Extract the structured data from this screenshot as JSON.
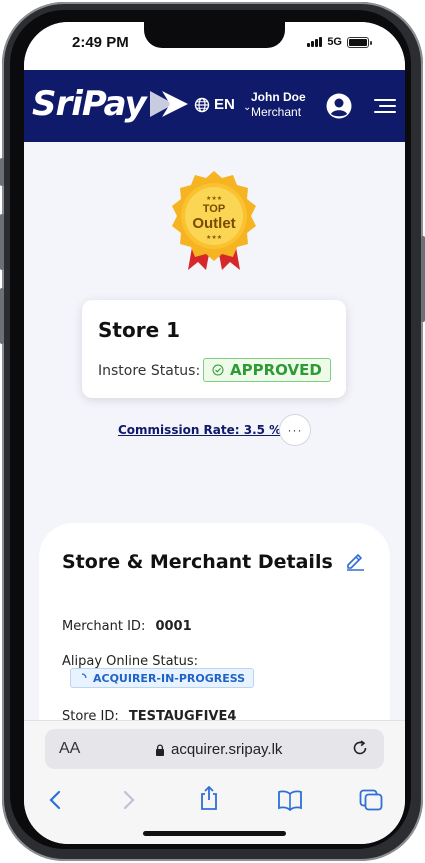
{
  "status_bar": {
    "time": "2:49 PM",
    "network": "5G"
  },
  "header": {
    "logo_text": "SriPay",
    "language": "EN",
    "user_name": "John Doe",
    "user_role": "Merchant",
    "brand_color": "#0f1a6b"
  },
  "badge": {
    "line1": "TOP",
    "line2": "Outlet"
  },
  "store": {
    "name": "Store 1",
    "instore_status_label": "Instore Status:",
    "instore_status_value": "APPROVED"
  },
  "commission": {
    "label": "Commission Rate: 3.5 %"
  },
  "more_button": {
    "label": "···"
  },
  "details": {
    "title": "Store & Merchant Details",
    "merchant_id_label": "Merchant ID:",
    "merchant_id_value": "0001",
    "alipay_status_label": "Alipay Online Status:",
    "alipay_status_value": "ACQUIRER-IN-PROGRESS",
    "store_id_label": "Store ID:",
    "store_id_value": "TESTAUGFIVE4"
  },
  "browser": {
    "aa_label": "AA",
    "url": "acquirer.sripay.lk"
  },
  "icons": [
    "globe-icon",
    "chevron-down-icon",
    "avatar-icon",
    "menu-icon",
    "check-circle-icon",
    "edit-icon",
    "spinner-icon",
    "lock-icon",
    "reload-icon",
    "back-icon",
    "forward-icon",
    "share-icon",
    "bookmarks-icon",
    "tabs-icon"
  ]
}
